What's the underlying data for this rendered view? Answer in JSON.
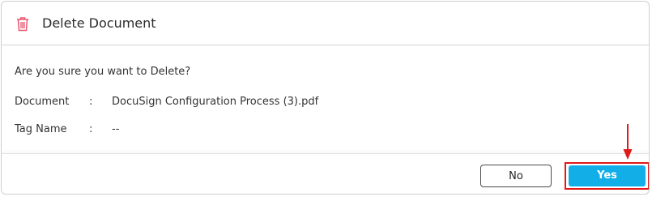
{
  "dialog": {
    "title": "Delete Document",
    "title_icon": "trash-icon",
    "prompt": "Are you sure you want to Delete?",
    "fields": [
      {
        "label": "Document",
        "separator": ":",
        "value": "DocuSign Configuration Process (3).pdf"
      },
      {
        "label": "Tag Name",
        "separator": ":",
        "value": "--"
      }
    ],
    "buttons": {
      "no_label": "No",
      "yes_label": "Yes"
    }
  },
  "colors": {
    "accent": "#11aee8",
    "danger_icon": "#e8566f",
    "annotation": "#e01919"
  }
}
